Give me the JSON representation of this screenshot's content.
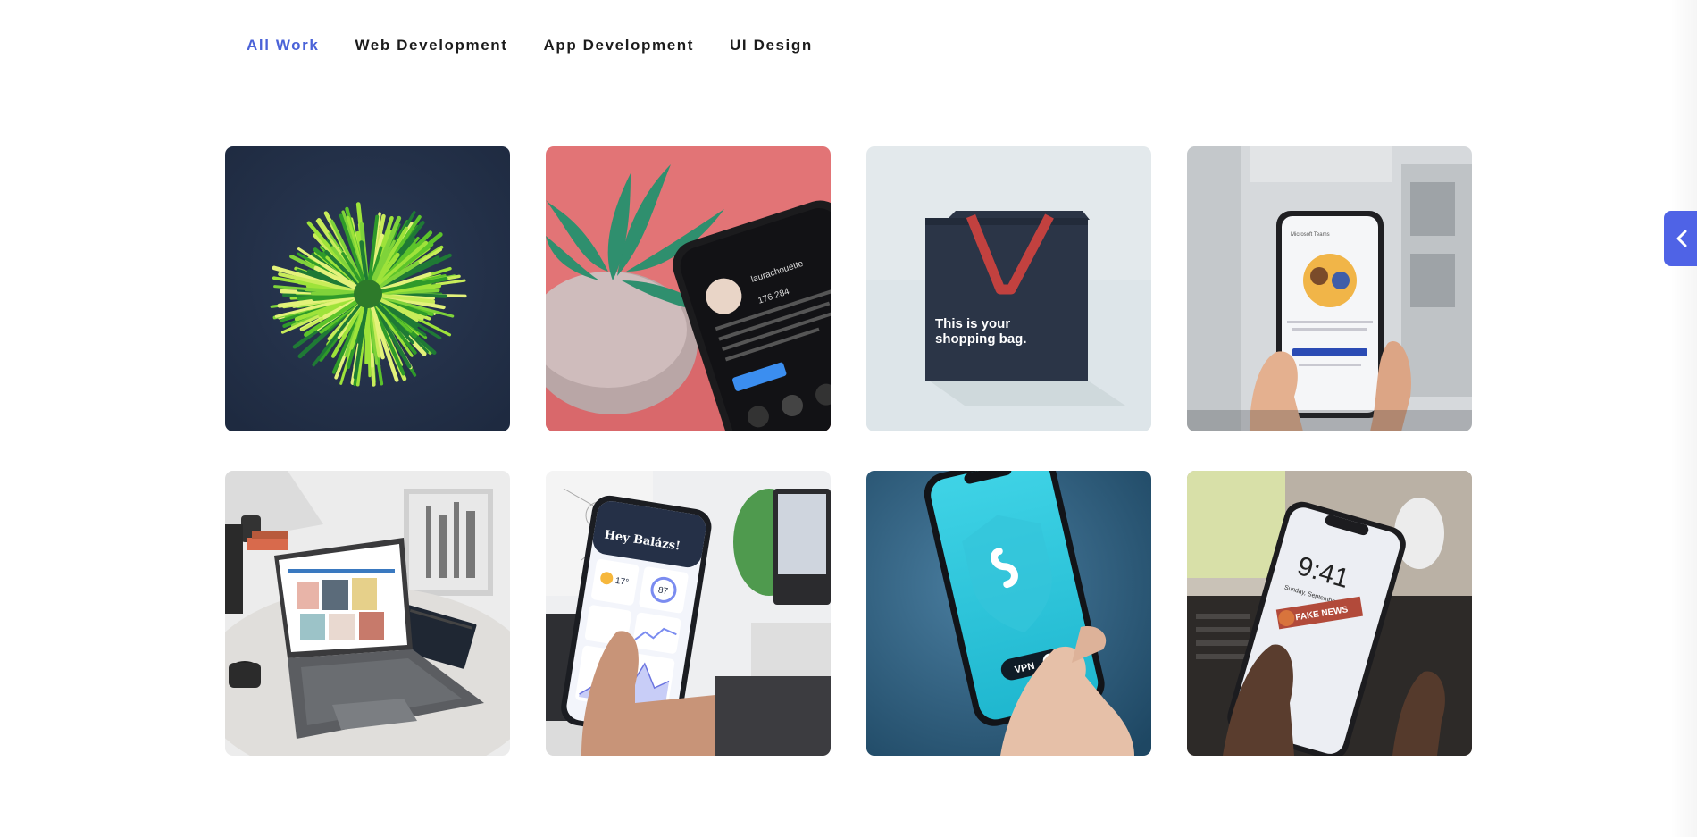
{
  "filters": [
    {
      "label": "All Work",
      "active": true
    },
    {
      "label": "Web Development",
      "active": false
    },
    {
      "label": "App Development",
      "active": false
    },
    {
      "label": "UI Design",
      "active": false
    }
  ],
  "portfolio": {
    "items": [
      {
        "subject": "green straws bundle",
        "category": "All Work"
      },
      {
        "subject": "phone with social profile beside plant",
        "category": "App Development"
      },
      {
        "subject": "shopping bag mockup",
        "category": "UI Design",
        "print_line1": "This is your",
        "print_line2": "shopping bag."
      },
      {
        "subject": "hands holding phone with Microsoft Teams",
        "category": "App Development",
        "screen_title": "Microsoft Teams"
      },
      {
        "subject": "laptop on marble table",
        "category": "Web Development"
      },
      {
        "subject": "hand holding weather app phone",
        "category": "App Development",
        "greeting": "Hey Balázs!",
        "temp": "17°",
        "score": "87"
      },
      {
        "subject": "hand holding VPN phone",
        "category": "App Development",
        "badge": "VPN"
      },
      {
        "subject": "hands holding lock screen phone",
        "category": "UI Design",
        "time": "9:41",
        "date": "Sunday, September 12",
        "stamp": "FAKE NEWS"
      }
    ]
  },
  "colors": {
    "accent": "#4a62d8",
    "toggle": "#4f63e6",
    "text": "#1c1c1c"
  },
  "side_toggle": {
    "icon": "chevron-left-icon"
  }
}
